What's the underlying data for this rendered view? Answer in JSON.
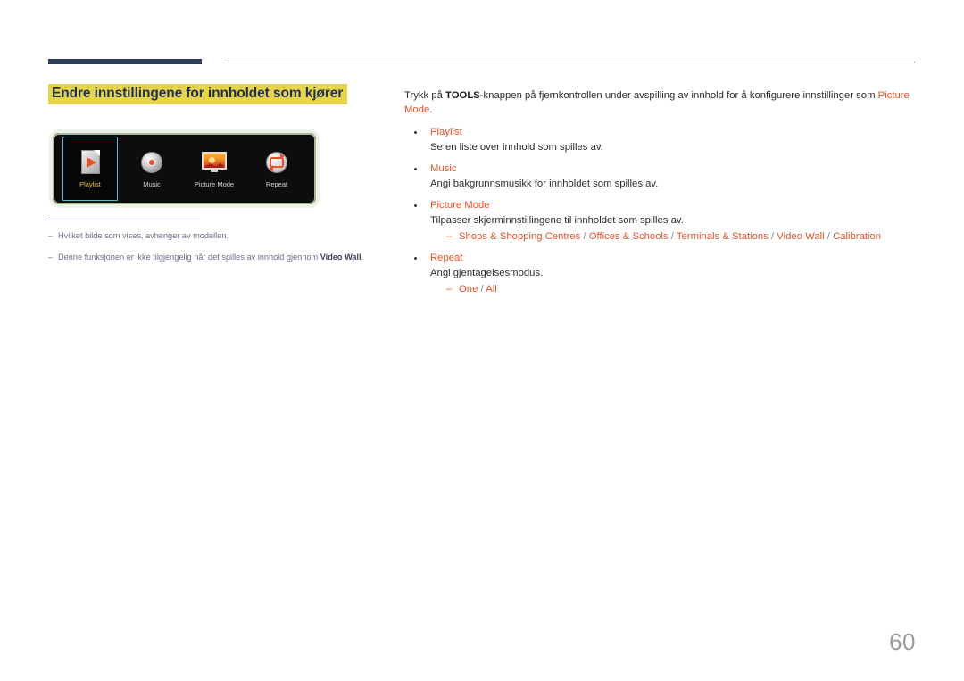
{
  "page": {
    "number": "60"
  },
  "heading": {
    "title": "Endre innstillingene for innholdet som kjører"
  },
  "figure": {
    "caption_items": [
      {
        "label": "Playlist",
        "icon": "playlist-page-play-icon",
        "selected": true
      },
      {
        "label": "Music",
        "icon": "music-cd-disc-icon",
        "selected": false
      },
      {
        "label": "Picture Mode",
        "icon": "picture-mode-tv-icon",
        "selected": false
      },
      {
        "label": "Repeat",
        "icon": "repeat-loop-icon",
        "selected": false
      }
    ]
  },
  "notes": [
    {
      "dash": "‒",
      "text": "Hvilket bilde som vises, avhenger av modellen."
    },
    {
      "dash": "‒",
      "text_before": "Denne funksjonen er ikke tilgjengelig når det spilles av innhold gjennom ",
      "bold": "Video Wall",
      "text_after": "."
    }
  ],
  "content": {
    "intro": {
      "lead": "Trykk på ",
      "bold": "TOOLS",
      "mid": "-knappen på fjernkontrollen under avspilling av innhold for å konfigurere innstillinger som ",
      "accent": "Picture Mode",
      "tail": "."
    },
    "bullets": [
      {
        "title": "Playlist",
        "desc": "Se en liste over innhold som spilles av."
      },
      {
        "title": "Music",
        "desc": "Angi bakgrunnsmusikk for innholdet som spilles av."
      },
      {
        "title": "Picture Mode",
        "desc": "Tilpasser skjerminnstillingene til innholdet som spilles av.",
        "sub_dash": "‒",
        "sub_options": [
          "Shops & Shopping Centres",
          "Offices & Schools",
          "Terminals & Stations",
          "Video Wall",
          "Calibration"
        ],
        "sub_separator": " / "
      },
      {
        "title": "Repeat",
        "desc": "Angi gjentagelsesmodus.",
        "sub_dash": "‒",
        "sub_options": [
          "One",
          "All"
        ],
        "sub_separator": " / "
      }
    ]
  },
  "colors": {
    "accent_orange": "#e4512a",
    "highlight_yellow": "#e6d54a",
    "heading_navy": "#22304f",
    "rule_navy": "#2e3a5c",
    "note_gray": "#6b7084",
    "page_number_gray": "#9b9b9b"
  }
}
